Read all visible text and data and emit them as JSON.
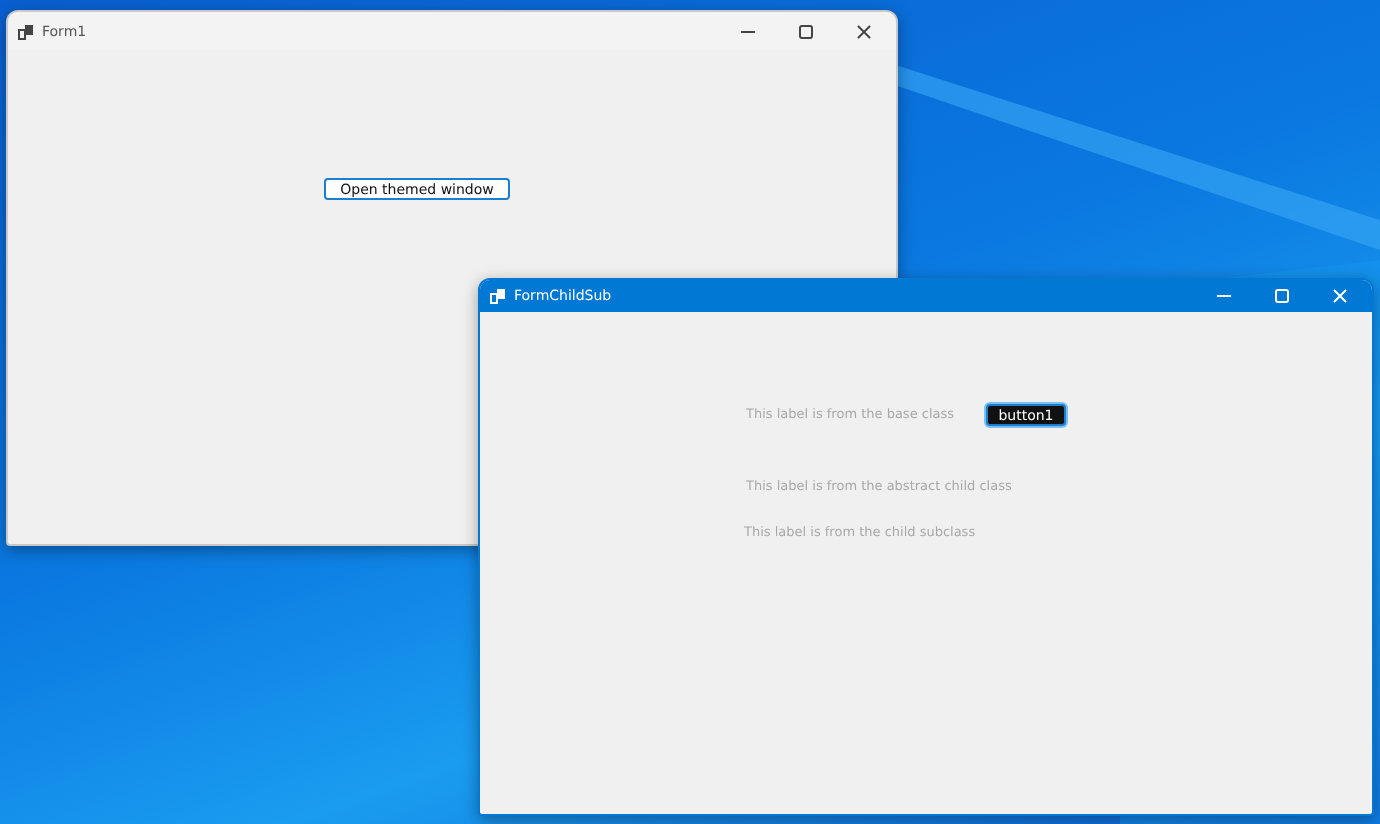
{
  "windows": [
    {
      "title": "Form1",
      "active": false,
      "controls": [
        {
          "kind": "button",
          "text": "Open themed window",
          "dark": false
        }
      ]
    },
    {
      "title": "FormChildSub",
      "active": true,
      "controls": [
        {
          "kind": "label",
          "text": "This label is from the base class"
        },
        {
          "kind": "button",
          "text": "button1",
          "dark": true
        },
        {
          "kind": "label",
          "text": "This label is from the abstract child class"
        },
        {
          "kind": "label",
          "text": "This label is from the child subclass"
        }
      ]
    }
  ]
}
